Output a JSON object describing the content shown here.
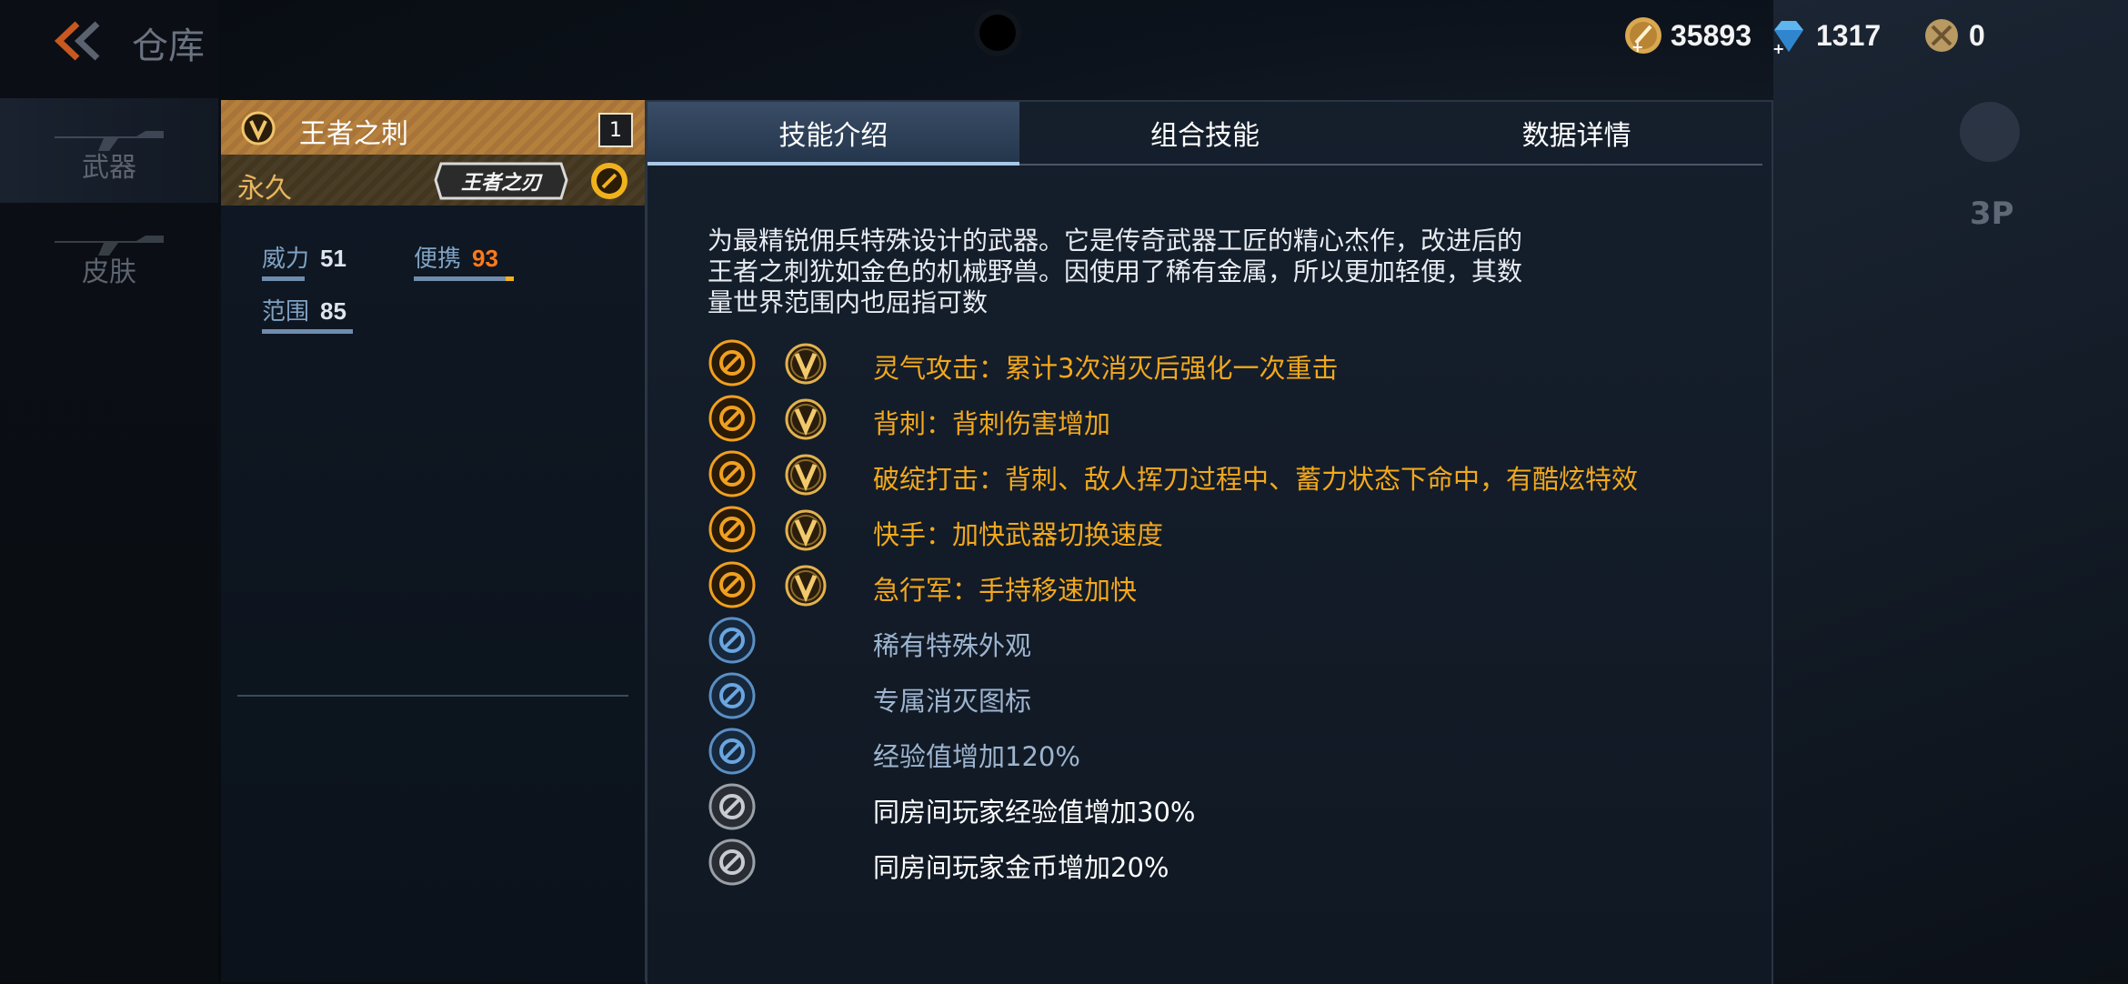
{
  "header": {
    "title": "仓库"
  },
  "currencies": [
    {
      "icon": "gold-coin-icon",
      "value": "35893"
    },
    {
      "icon": "diamond-icon",
      "value": "1317"
    },
    {
      "icon": "honor-coin-icon",
      "value": "0"
    }
  ],
  "sidebar": {
    "items": [
      {
        "label": "武器"
      },
      {
        "label": "皮肤"
      }
    ]
  },
  "right_controls": {
    "view_label": "3P"
  },
  "weapon": {
    "name": "王者之刺",
    "count": "1",
    "duration": "永久",
    "logo_text": "王者之刃",
    "stats": [
      {
        "label": "威力",
        "value": "51",
        "level": 0.4
      },
      {
        "label": "便携",
        "value": "93",
        "level": 0.93
      },
      {
        "label": "范围",
        "value": "85",
        "level": 0.85
      }
    ]
  },
  "tabs": [
    {
      "label": "技能介绍",
      "active": true
    },
    {
      "label": "组合技能",
      "active": false
    },
    {
      "label": "数据详情",
      "active": false
    }
  ],
  "description_lines": [
    "为最精锐佣兵特殊设计的武器。它是传奇武器工匠的精心杰作，改进后的",
    "王者之刺犹如金色的机械野兽。因使用了稀有金属，所以更加轻便，其数",
    "量世界范围内也屈指可数"
  ],
  "skills": [
    {
      "text": "灵气攻击：累计3次消灭后强化一次重击",
      "icon": "aura-attack-icon",
      "tier": "gold"
    },
    {
      "text": "背刺：背刺伤害增加",
      "icon": "backstab-icon",
      "tier": "gold"
    },
    {
      "text": "破绽打击：背刺、敌人挥刀过程中、蓄力状态下命中，有酷炫特效",
      "icon": "weakpoint-strike-icon",
      "tier": "gold"
    },
    {
      "text": "快手：加快武器切换速度",
      "icon": "quick-hand-icon",
      "tier": "gold"
    },
    {
      "text": "急行军：手持移速加快",
      "icon": "forced-march-icon",
      "tier": "gold"
    },
    {
      "text": "稀有特殊外观",
      "icon": "rare-appearance-star-icon",
      "tier": "blue"
    },
    {
      "text": "专属消灭图标",
      "icon": "exclusive-kill-icon",
      "tier": "blue"
    },
    {
      "text": "经验值增加120%",
      "icon": "exp-boost-icon",
      "tier": "blue"
    },
    {
      "text": "同房间玩家经验值增加30%",
      "icon": "room-exp-icon",
      "tier": "white"
    },
    {
      "text": "同房间玩家金币增加20%",
      "icon": "room-gold-icon",
      "tier": "white"
    }
  ],
  "colors": {
    "gold": "#f2a81d",
    "blue_text": "#9db4cf",
    "accent": "#e6b560"
  }
}
